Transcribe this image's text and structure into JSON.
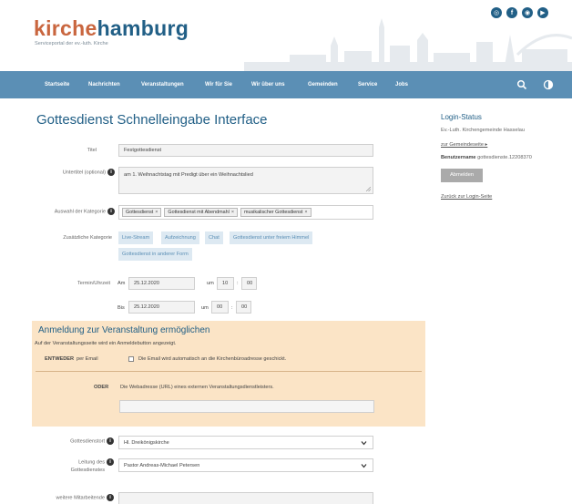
{
  "header": {
    "logo_part1": "kirche",
    "logo_part2": "hamburg",
    "tagline": "Serviceportal der ev.-luth. Kirche",
    "social_icons": [
      "instagram-icon",
      "facebook-icon",
      "podcast-icon",
      "youtube-icon"
    ]
  },
  "nav": {
    "items": [
      "Startseite",
      "Nachrichten",
      "Veranstaltungen",
      "Wir für Sie",
      "Wir über uns",
      "Gemeinden",
      "Service",
      "Jobs"
    ],
    "icons": [
      "search-icon",
      "contrast-icon"
    ],
    "background": "#5b8fb5"
  },
  "colors": {
    "brand_blue": "#215f86",
    "brand_orange": "#c9663f",
    "section_bg": "#fbe4c6",
    "pill_bg": "#dde9f2"
  },
  "page_title": "Gottesdienst Schnelleingabe Interface",
  "form": {
    "titel_label": "Titel",
    "titel_value": "Festgottesdienst",
    "untertitel_label": "Untertitel (optional)",
    "untertitel_value": "am 1. Weihnachtstag mit Predigt über ein Weihnachtslied",
    "kategorie_label": "Auswahl der Kategorie",
    "kategorie_tags": [
      "Gottesdienst",
      "Gottesdienst mit Abendmahl",
      "musikalischer Gottesdienst"
    ],
    "zusatz_label": "Zusätzliche Kategorie",
    "zusatz_options": [
      "Live-Stream",
      "Aufzeichnung",
      "Chat",
      "Gottesdienst unter freiem Himmel",
      "Gottesdienst in anderer Form"
    ],
    "termin_label": "Termin/Uhrzeit",
    "am_label": "Am",
    "am_date": "25.12.2020",
    "um_label": "um",
    "am_hour": "10",
    "am_min": "00",
    "bis_label": "Bis",
    "bis_date": "25.12.2020",
    "bis_hour": "00",
    "bis_min": "00",
    "time_sep": ":",
    "ort_label": "Gottesdienstort",
    "ort_value": "Hl. Dreikönigskirche",
    "leitung_label_1": "Leitung des",
    "leitung_label_2": "Gottesdienstes",
    "leitung_value": "Pastor Andreas-Michael Petersen",
    "weitere_label": "weitere Mitarbeitende"
  },
  "anmeldung": {
    "title": "Anmeldung zur Veranstaltung ermöglichen",
    "description": "Auf der Veranstaltungsseite wird ein Anmeldebutton angezeigt.",
    "entweder_label": "ENTWEDER",
    "per_email_label": "per Email",
    "email_text": "Die Email wird automatisch an die Kirchenbüroadresse geschickt.",
    "oder_label": "ODER",
    "url_text": "Die Webadresse (URL) eines externen Veranstaltungsdienstleisters."
  },
  "sidebar": {
    "title": "Login-Status",
    "org": "Ev.-Luth. Kirchengemeinde Hasselau",
    "gemeindeseite_link": "zur Gemeindeseite",
    "benutzername_label": "Benutzername",
    "benutzername_value": "gottesdienste.12208370",
    "logout_button": "Abmelden",
    "back_link": "Zurück zur Login-Seite"
  }
}
